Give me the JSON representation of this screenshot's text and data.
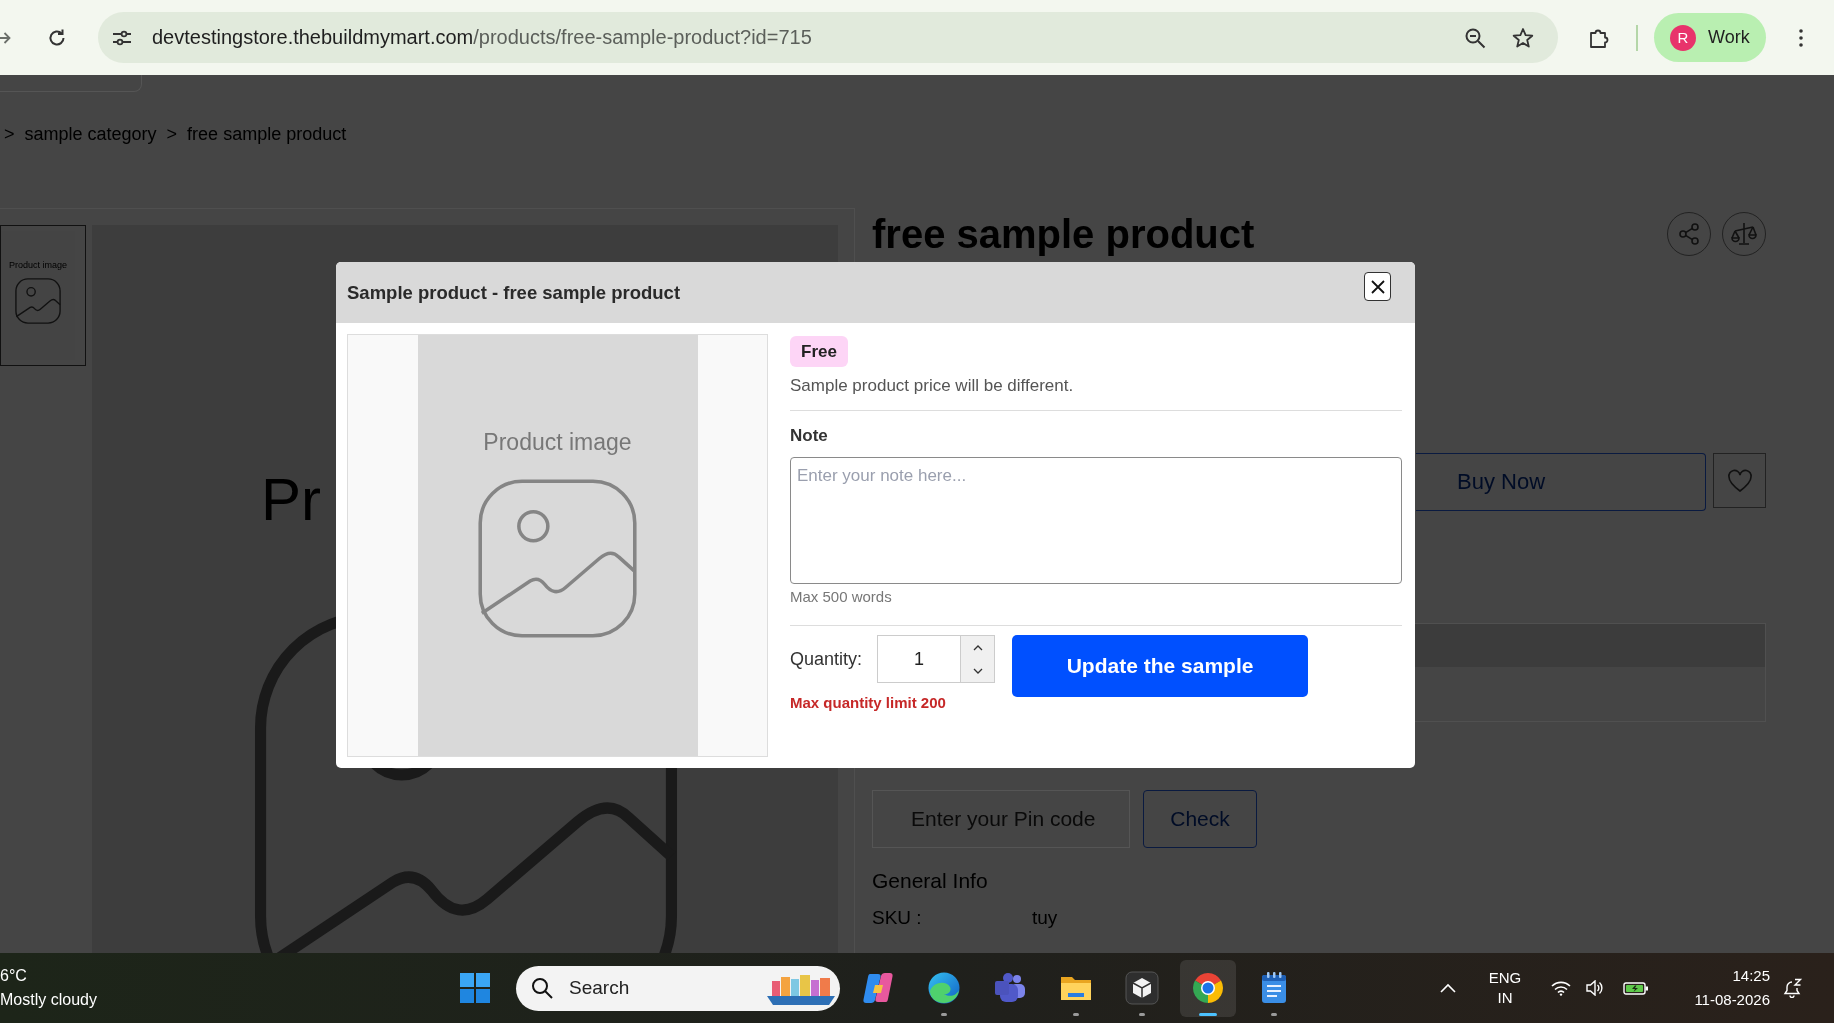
{
  "browser": {
    "url_host": "devtestingstore.thebuildmymart.com",
    "url_path": "/products/free-sample-product?id=715",
    "profile": {
      "initial": "R",
      "name": "Work"
    }
  },
  "page": {
    "breadcrumb": [
      {
        "separator": ">",
        "label": "sample category"
      },
      {
        "separator": ">",
        "label": "free sample product"
      }
    ],
    "gallery": {
      "thumbnail_caption": "Product image",
      "main_caption": "Pr"
    },
    "product": {
      "title": "free sample product",
      "buy_button": "Buy Now",
      "pincode": {
        "placeholder": "Enter your Pin code",
        "button": "Check"
      },
      "general_info": {
        "heading": "General Info",
        "rows": [
          {
            "label": "SKU :",
            "value": "tuy"
          }
        ]
      }
    }
  },
  "modal": {
    "title": "Sample product - free sample product",
    "image_caption": "Product image",
    "badge": "Free",
    "price_note": "Sample product price will be different.",
    "note": {
      "label": "Note",
      "placeholder": "Enter your note here...",
      "hint": "Max 500 words"
    },
    "quantity": {
      "label": "Quantity:",
      "value": "1",
      "limit": "Max quantity limit 200"
    },
    "submit": "Update the sample"
  },
  "taskbar": {
    "weather": {
      "temperature": "6°C",
      "condition": "Mostly cloudy"
    },
    "search": {
      "label": "Search"
    },
    "apps": [
      {
        "kind": "assistant",
        "running": false,
        "selected": false
      },
      {
        "kind": "edge",
        "running": true,
        "selected": false
      },
      {
        "kind": "teams",
        "running": false,
        "selected": false
      },
      {
        "kind": "files",
        "running": true,
        "selected": false
      },
      {
        "kind": "package",
        "running": true,
        "selected": false
      },
      {
        "kind": "chrome",
        "running": true,
        "selected": true
      },
      {
        "kind": "notepad",
        "running": true,
        "selected": false
      }
    ],
    "language": {
      "code": "ENG",
      "region": "IN"
    },
    "clock": {
      "time": "14:25",
      "date": "11-08-2026"
    }
  }
}
